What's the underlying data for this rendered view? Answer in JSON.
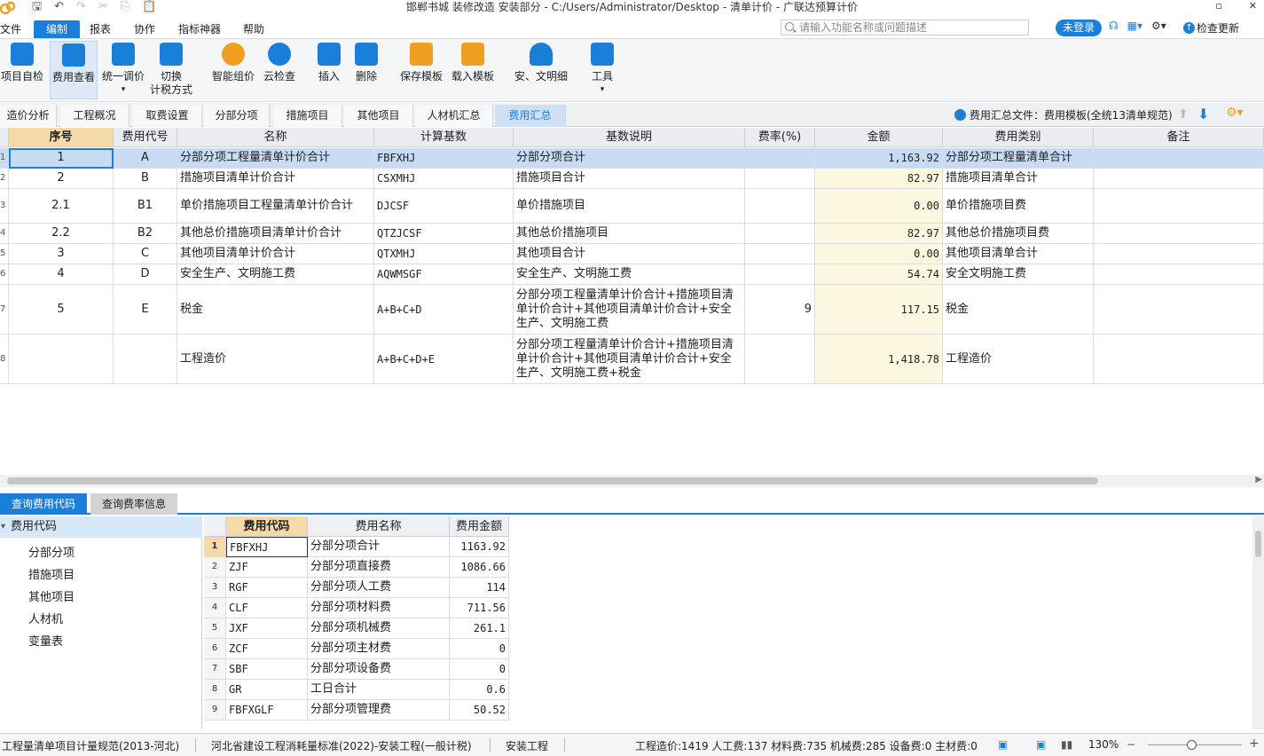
{
  "titlebar": {
    "title": "邯郸书城 装修改造 安装部分  -  C:/Users/Administrator/Desktop  -  清单计价  -  广联达预算计价",
    "restore_glyph": "▫",
    "close_glyph": "✕"
  },
  "menubar": {
    "items": [
      "文件",
      "编制",
      "报表",
      "协作",
      "指标神器",
      "帮助"
    ],
    "search_placeholder": "请输入功能名称或问题描述",
    "login": "未登录",
    "update": "检查更新"
  },
  "toolbar": {
    "buttons": [
      {
        "label": "项目自检",
        "label2": "",
        "icon": "check-doc-icon",
        "color": "#1a7fd8"
      },
      {
        "label": "费用查看",
        "label2": "",
        "icon": "fee-view-icon",
        "color": "#1a7fd8"
      },
      {
        "label": "统一调价",
        "label2": "▾",
        "icon": "price-adjust-icon",
        "color": "#1a7fd8"
      },
      {
        "label": "切换",
        "label2": "计税方式",
        "icon": "tax-switch-icon",
        "color": "#1a7fd8"
      },
      {
        "label": "智能组价",
        "label2": "",
        "icon": "smart-price-icon",
        "color": "#f0a020"
      },
      {
        "label": "云检查",
        "label2": "",
        "icon": "cloud-check-icon",
        "color": "#1a7fd8"
      },
      {
        "label": "插入",
        "label2": "",
        "icon": "insert-icon",
        "color": "#1a7fd8"
      },
      {
        "label": "删除",
        "label2": "",
        "icon": "delete-icon",
        "color": "#1a7fd8"
      },
      {
        "label": "保存模板",
        "label2": "",
        "icon": "save-template-icon",
        "color": "#f0a020"
      },
      {
        "label": "载入模板",
        "label2": "",
        "icon": "load-template-icon",
        "color": "#f0a020"
      },
      {
        "label": "安、文明细",
        "label2": "",
        "icon": "safety-helmet-icon",
        "color": "#1a7fd8"
      },
      {
        "label": "工具",
        "label2": "▾",
        "icon": "tools-icon",
        "color": "#1a7fd8"
      }
    ]
  },
  "tabs": [
    "造价分析",
    "工程概况",
    "取费设置",
    "分部分项",
    "措施项目",
    "其他项目",
    "人材机汇总",
    "费用汇总"
  ],
  "summary_file": "费用汇总文件：费用模板(全统13清单规范)",
  "grid": {
    "headers": [
      "序号",
      "费用代号",
      "名称",
      "计算基数",
      "基数说明",
      "费率(%)",
      "金额",
      "费用类别",
      "备注"
    ],
    "rows": [
      {
        "rn": "1",
        "seq": "1",
        "code": "A",
        "name": "分部分项工程量清单计价合计",
        "base": "FBFXHJ",
        "desc": "分部分项合计",
        "rate": "",
        "amount": "1,163.92",
        "category": "分部分项工程量清单合计",
        "note": ""
      },
      {
        "rn": "2",
        "seq": "2",
        "code": "B",
        "name": "措施项目清单计价合计",
        "base": "CSXMHJ",
        "desc": "措施项目合计",
        "rate": "",
        "amount": "82.97",
        "category": "措施项目清单合计",
        "note": ""
      },
      {
        "rn": "3",
        "seq": "2.1",
        "code": "B1",
        "name": "单价措施项目工程量清单计价合计",
        "base": "DJCSF",
        "desc": "单价措施项目",
        "rate": "",
        "amount": "0.00",
        "category": "单价措施项目费",
        "note": ""
      },
      {
        "rn": "4",
        "seq": "2.2",
        "code": "B2",
        "name": "其他总价措施项目清单计价合计",
        "base": "QTZJCSF",
        "desc": "其他总价措施项目",
        "rate": "",
        "amount": "82.97",
        "category": "其他总价措施项目费",
        "note": ""
      },
      {
        "rn": "5",
        "seq": "3",
        "code": "C",
        "name": "其他项目清单计价合计",
        "base": "QTXMHJ",
        "desc": "其他项目合计",
        "rate": "",
        "amount": "0.00",
        "category": "其他项目清单合计",
        "note": ""
      },
      {
        "rn": "6",
        "seq": "4",
        "code": "D",
        "name": "安全生产、文明施工费",
        "base": "AQWMSGF",
        "desc": "安全生产、文明施工费",
        "rate": "",
        "amount": "54.74",
        "category": "安全文明施工费",
        "note": ""
      },
      {
        "rn": "7",
        "seq": "5",
        "code": "E",
        "name": "税金",
        "base": "A+B+C+D",
        "desc": "分部分项工程量清单计价合计+措施项目清单计价合计+其他项目清单计价合计+安全生产、文明施工费",
        "rate": "9",
        "amount": "117.15",
        "category": "税金",
        "note": ""
      },
      {
        "rn": "8",
        "seq": "",
        "code": "",
        "name": "工程造价",
        "base": "A+B+C+D+E",
        "desc": "分部分项工程量清单计价合计+措施项目清单计价合计+其他项目清单计价合计+安全生产、文明施工费+税金",
        "rate": "",
        "amount": "1,418.78",
        "category": "工程造价",
        "note": ""
      }
    ]
  },
  "bottom": {
    "tabs": [
      "查询费用代码",
      "查询费率信息"
    ],
    "tree_root": "费用代码",
    "tree_nodes": [
      "分部分项",
      "措施项目",
      "其他项目",
      "人材机",
      "变量表"
    ],
    "table_headers": [
      "费用代码",
      "费用名称",
      "费用金额"
    ],
    "table_rows": [
      {
        "n": "1",
        "code": "FBFXHJ",
        "name": "分部分项合计",
        "amount": "1163.92"
      },
      {
        "n": "2",
        "code": "ZJF",
        "name": "分部分项直接费",
        "amount": "1086.66"
      },
      {
        "n": "3",
        "code": "RGF",
        "name": "分部分项人工费",
        "amount": "114"
      },
      {
        "n": "4",
        "code": "CLF",
        "name": "分部分项材料费",
        "amount": "711.56"
      },
      {
        "n": "5",
        "code": "JXF",
        "name": "分部分项机械费",
        "amount": "261.1"
      },
      {
        "n": "6",
        "code": "ZCF",
        "name": "分部分项主材费",
        "amount": "0"
      },
      {
        "n": "7",
        "code": "SBF",
        "name": "分部分项设备费",
        "amount": "0"
      },
      {
        "n": "8",
        "code": "GR",
        "name": "工日合计",
        "amount": "0.6"
      },
      {
        "n": "9",
        "code": "FBFXGLF",
        "name": "分部分项管理费",
        "amount": "50.52"
      }
    ]
  },
  "statusbar": {
    "spec": "工程量清单项目计量规范(2013-河北)",
    "standard": "河北省建设工程消耗量标准(2022)-安装工程(一般计税)",
    "type": "安装工程",
    "totals": "工程造价:1419   人工费:137   材料费:735   机械费:285   设备费:0   主材费:0",
    "zoom": "130%",
    "zoom_level": 0.46
  }
}
